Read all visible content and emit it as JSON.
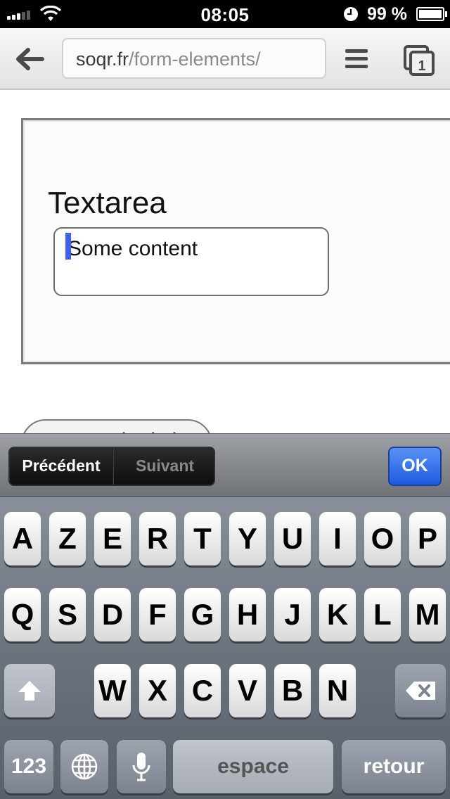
{
  "status_bar": {
    "time": "08:05",
    "battery_percent": "99 %",
    "signal_icon": "signal-bars-icon",
    "wifi_icon": "wifi-icon",
    "clock_icon": "alarm-clock-icon",
    "battery_icon": "battery-icon"
  },
  "browser": {
    "url_domain": "soqr.fr",
    "url_path": "/form-elements/",
    "back_icon": "back-arrow-icon",
    "menu_icon": "menu-icon",
    "tabs_icon": "tabs-icon",
    "tab_count": "1"
  },
  "page": {
    "textarea_label": "Textarea",
    "textarea_value": "Some content",
    "submit_label": "type submit :)"
  },
  "form_assistant": {
    "previous_label": "Précédent",
    "next_label": "Suivant",
    "done_label": "OK"
  },
  "keyboard": {
    "row1": [
      "A",
      "Z",
      "E",
      "R",
      "T",
      "Y",
      "U",
      "I",
      "O",
      "P"
    ],
    "row2": [
      "Q",
      "S",
      "D",
      "F",
      "G",
      "H",
      "J",
      "K",
      "L",
      "M"
    ],
    "row3": [
      "W",
      "X",
      "C",
      "V",
      "B",
      "N"
    ],
    "numbers_label": "123",
    "space_label": "espace",
    "return_label": "retour",
    "shift_icon": "shift-arrow-icon",
    "delete_icon": "backspace-icon",
    "globe_icon": "globe-icon",
    "mic_icon": "microphone-icon"
  },
  "colors": {
    "ok_button": "#2a66e8",
    "caret": "#3f5ff0"
  }
}
